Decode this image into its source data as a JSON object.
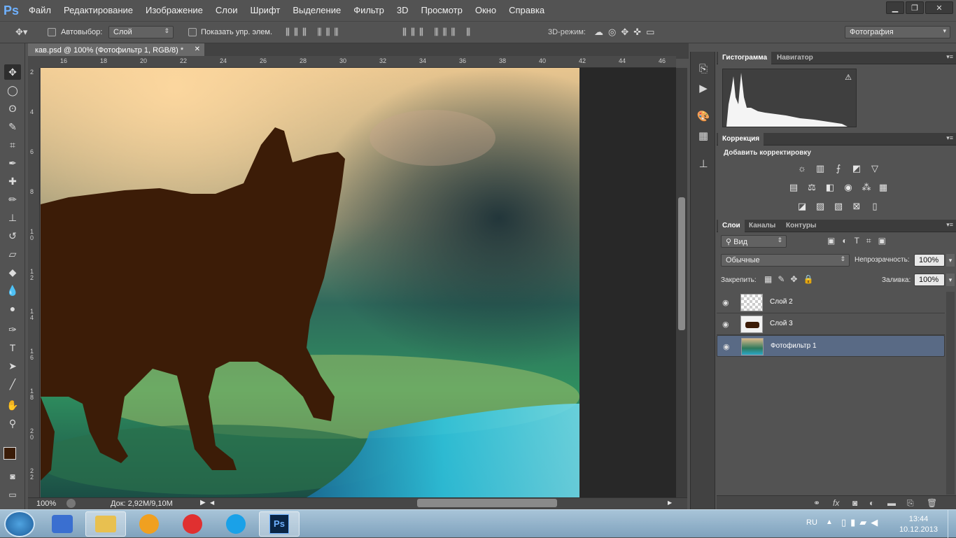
{
  "menubar": {
    "logo": "Ps",
    "items": [
      "Файл",
      "Редактирование",
      "Изображение",
      "Слои",
      "Шрифт",
      "Выделение",
      "Фильтр",
      "3D",
      "Просмотр",
      "Окно",
      "Справка"
    ]
  },
  "options": {
    "autoselect_label": "Автовыбор:",
    "autoselect_value": "Слой",
    "show_controls_label": "Показать упр. элем.",
    "mode3d_label": "3D-режим:",
    "workspace_value": "Фотография"
  },
  "document": {
    "tab_title": "кав.psd @ 100% (Фотофильтр 1, RGB/8) *",
    "ruler_h": [
      "16",
      "18",
      "20",
      "22",
      "24",
      "26",
      "28",
      "30",
      "32",
      "34",
      "36",
      "38",
      "40",
      "42",
      "44",
      "46"
    ],
    "ruler_v": [
      "2",
      "4",
      "6",
      "8",
      "1 0",
      "1 2",
      "1 4",
      "1 6",
      "1 8",
      "2 0",
      "2 2"
    ],
    "zoom": "100%",
    "doc_size": "Док: 2,92M/9,10M"
  },
  "panels": {
    "histogram_tab": "Гистограмма",
    "navigator_tab": "Навигатор",
    "correction_tab": "Коррекция",
    "add_adjustment": "Добавить корректировку",
    "layers_tab": "Слои",
    "channels_tab": "Каналы",
    "paths_tab": "Контуры",
    "filter_kind": "Вид",
    "blend_mode": "Обычные",
    "opacity_label": "Непрозрачность:",
    "opacity_value": "100%",
    "lock_label": "Закрепить:",
    "fill_label": "Заливка:",
    "fill_value": "100%",
    "layers": [
      {
        "name": "Слой 2",
        "selected": false
      },
      {
        "name": "Слой 3",
        "selected": false
      },
      {
        "name": "Фотофильтр 1",
        "selected": true
      }
    ]
  },
  "taskbar": {
    "lang": "RU",
    "time": "13:44",
    "date": "10.12.2013",
    "apps": [
      "people-icon",
      "explorer-icon",
      "aimp-icon",
      "yandex-icon",
      "skype-icon",
      "photoshop-icon"
    ]
  },
  "colors": {
    "accent": "#6fb1ff",
    "selected_layer": "#596a85",
    "panel_bg": "#535353"
  }
}
